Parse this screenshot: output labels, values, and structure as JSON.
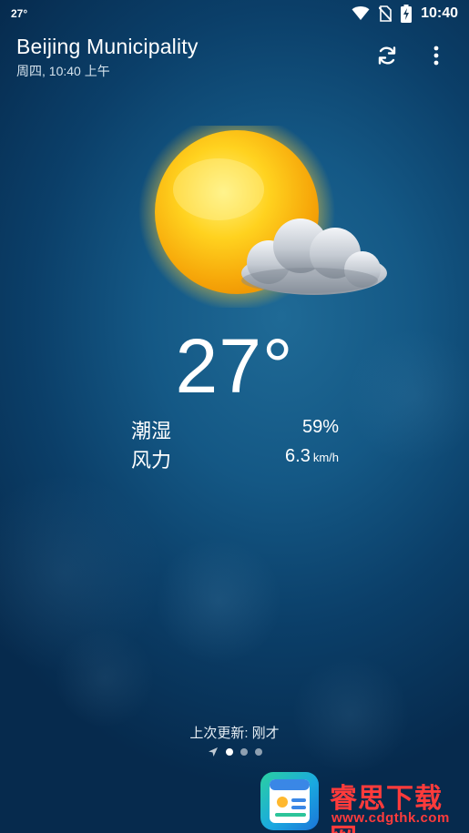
{
  "status_bar": {
    "temperature": "27°",
    "time": "10:40"
  },
  "header": {
    "location": "Beijing Municipality",
    "date_line": "周四, 10:40 上午"
  },
  "weather": {
    "condition_icon": "partly-sunny-icon",
    "temperature": "27°",
    "details": [
      {
        "label": "潮湿",
        "value": "59%",
        "unit": ""
      },
      {
        "label": "风力",
        "value": "6.3",
        "unit": "km/h"
      }
    ]
  },
  "footer": {
    "last_update": "上次更新:  刚才",
    "pages": {
      "count": 3,
      "active": 0
    }
  },
  "watermark": {
    "title": "睿思下载网",
    "url": "www.cdgthk.com"
  },
  "colors": {
    "background": "#0b3f69",
    "watermark_red": "#ff3b3b"
  }
}
